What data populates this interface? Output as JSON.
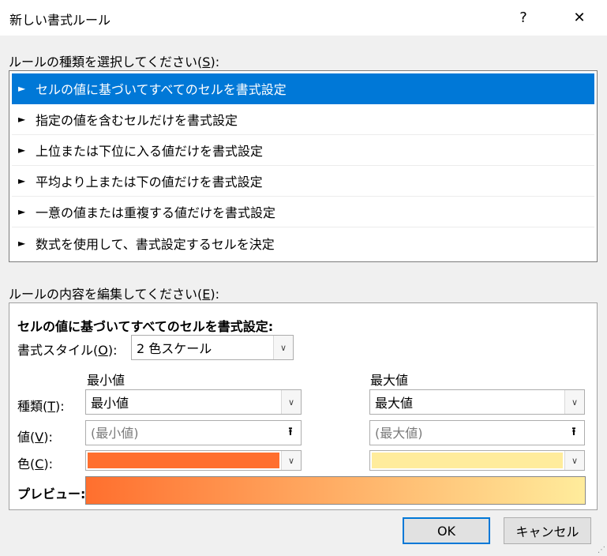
{
  "window": {
    "title": "新しい書式ルール",
    "help_label": "?",
    "close_label": "✕"
  },
  "rule_type": {
    "label": "ルールの種類を選択してください(",
    "label_key": "S",
    "label_end": "):",
    "items": [
      {
        "label": "セルの値に基づいてすべてのセルを書式設定",
        "selected": true
      },
      {
        "label": "指定の値を含むセルだけを書式設定",
        "selected": false
      },
      {
        "label": "上位または下位に入る値だけを書式設定",
        "selected": false
      },
      {
        "label": "平均より上または下の値だけを書式設定",
        "selected": false
      },
      {
        "label": "一意の値または重複する値だけを書式設定",
        "selected": false
      },
      {
        "label": "数式を使用して、書式設定するセルを決定",
        "selected": false
      }
    ]
  },
  "edit": {
    "label": "ルールの内容を編集してください(",
    "label_key": "E",
    "label_end": "):",
    "heading": "セルの値に基づいてすべてのセルを書式設定:",
    "style_label": "書式スタイル(",
    "style_key": "O",
    "style_end": "):",
    "style_value": "2 色スケール",
    "min_header": "最小値",
    "max_header": "最大値",
    "type_label": "種類(",
    "type_key": "T",
    "type_end": "):",
    "min_type": "最小値",
    "max_type": "最大値",
    "value_label": "値(",
    "value_key": "V",
    "value_end": "):",
    "min_value_placeholder": "(最小値)",
    "max_value_placeholder": "(最大値)",
    "color_label": "色(",
    "color_key": "C",
    "color_end": "):",
    "min_color": "#ff6f2e",
    "max_color": "#ffec9c",
    "preview_label": "プレビュー:"
  },
  "buttons": {
    "ok": "OK",
    "cancel": "キャンセル"
  },
  "icons": {
    "rule_arrow": "►",
    "dropdown": "∨",
    "upload": "⭱"
  }
}
